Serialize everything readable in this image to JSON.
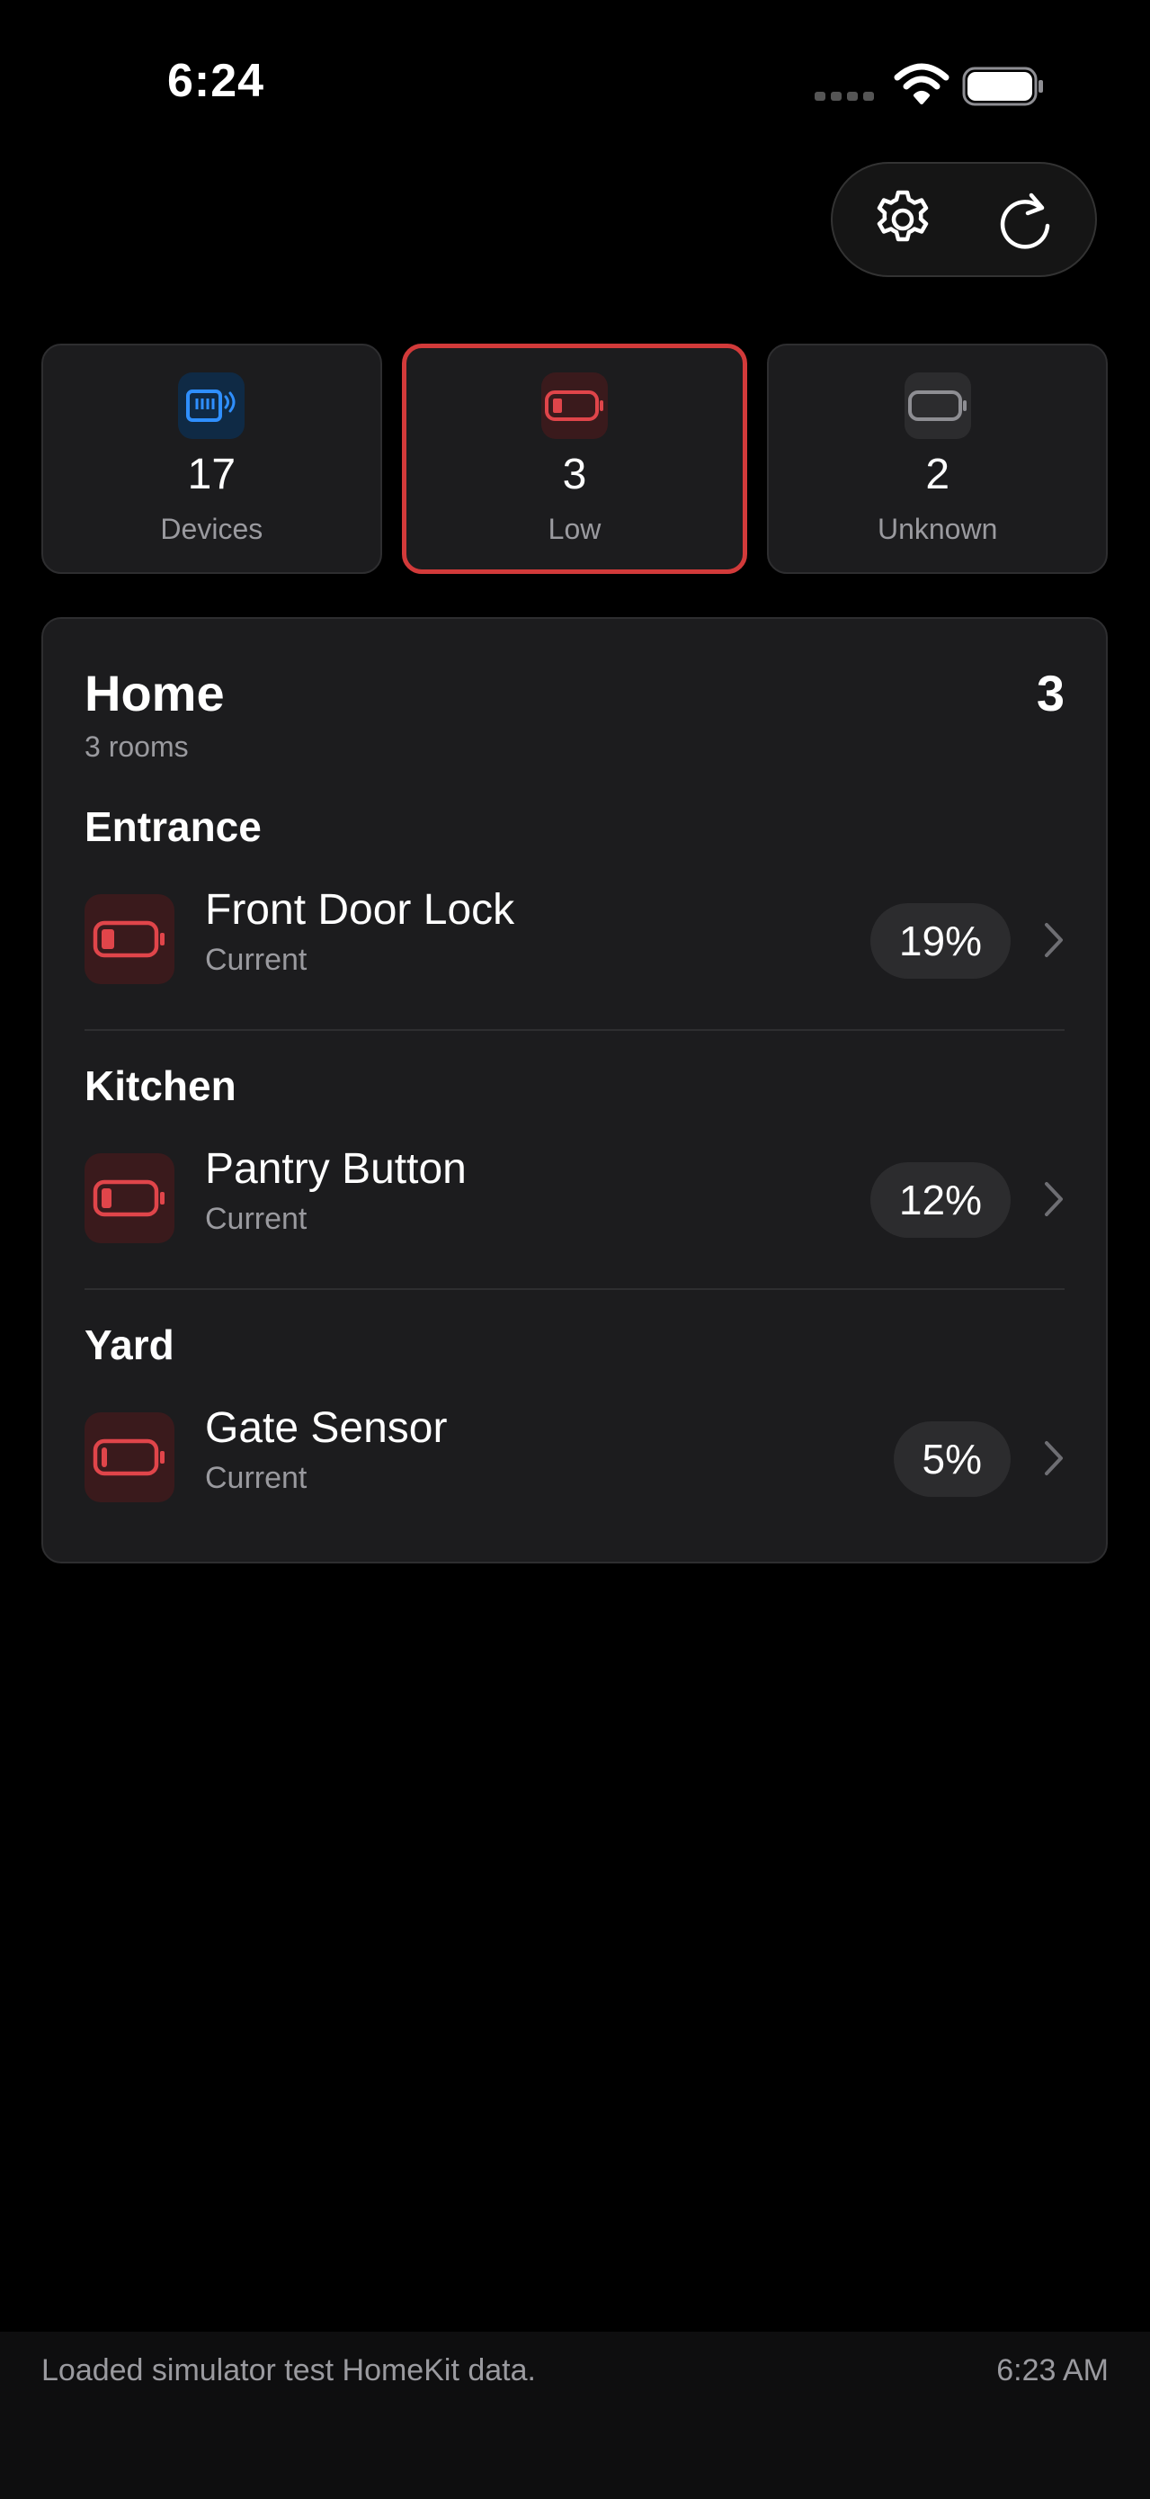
{
  "status_bar": {
    "time": "6:24"
  },
  "toolbar": {
    "settings_icon": "gear-icon",
    "refresh_icon": "refresh-icon"
  },
  "summary": {
    "devices": {
      "count": "17",
      "label": "Devices",
      "icon": "hub-icon",
      "color": "#2f8fff"
    },
    "low": {
      "count": "3",
      "label": "Low",
      "icon": "battery-low-icon",
      "color": "#e0454a",
      "selected": true
    },
    "unknown": {
      "count": "2",
      "label": "Unknown",
      "icon": "battery-empty-icon",
      "color": "#8e8e93"
    }
  },
  "home": {
    "title": "Home",
    "count": "3",
    "subtitle": "3 rooms",
    "rooms": [
      {
        "name": "Entrance",
        "device": {
          "name": "Front Door Lock",
          "status": "Current",
          "percent": "19%",
          "level": 0.19
        }
      },
      {
        "name": "Kitchen",
        "device": {
          "name": "Pantry Button",
          "status": "Current",
          "percent": "12%",
          "level": 0.12
        }
      },
      {
        "name": "Yard",
        "device": {
          "name": "Gate Sensor",
          "status": "Current",
          "percent": "5%",
          "level": 0.05
        }
      }
    ]
  },
  "footer": {
    "message": "Loaded simulator test HomeKit data.",
    "time": "6:23 AM"
  },
  "colors": {
    "accent_red": "#e0454a",
    "accent_blue": "#2f8fff",
    "card_bg": "#1c1c1e",
    "secondary_text": "#9a9a9f"
  }
}
